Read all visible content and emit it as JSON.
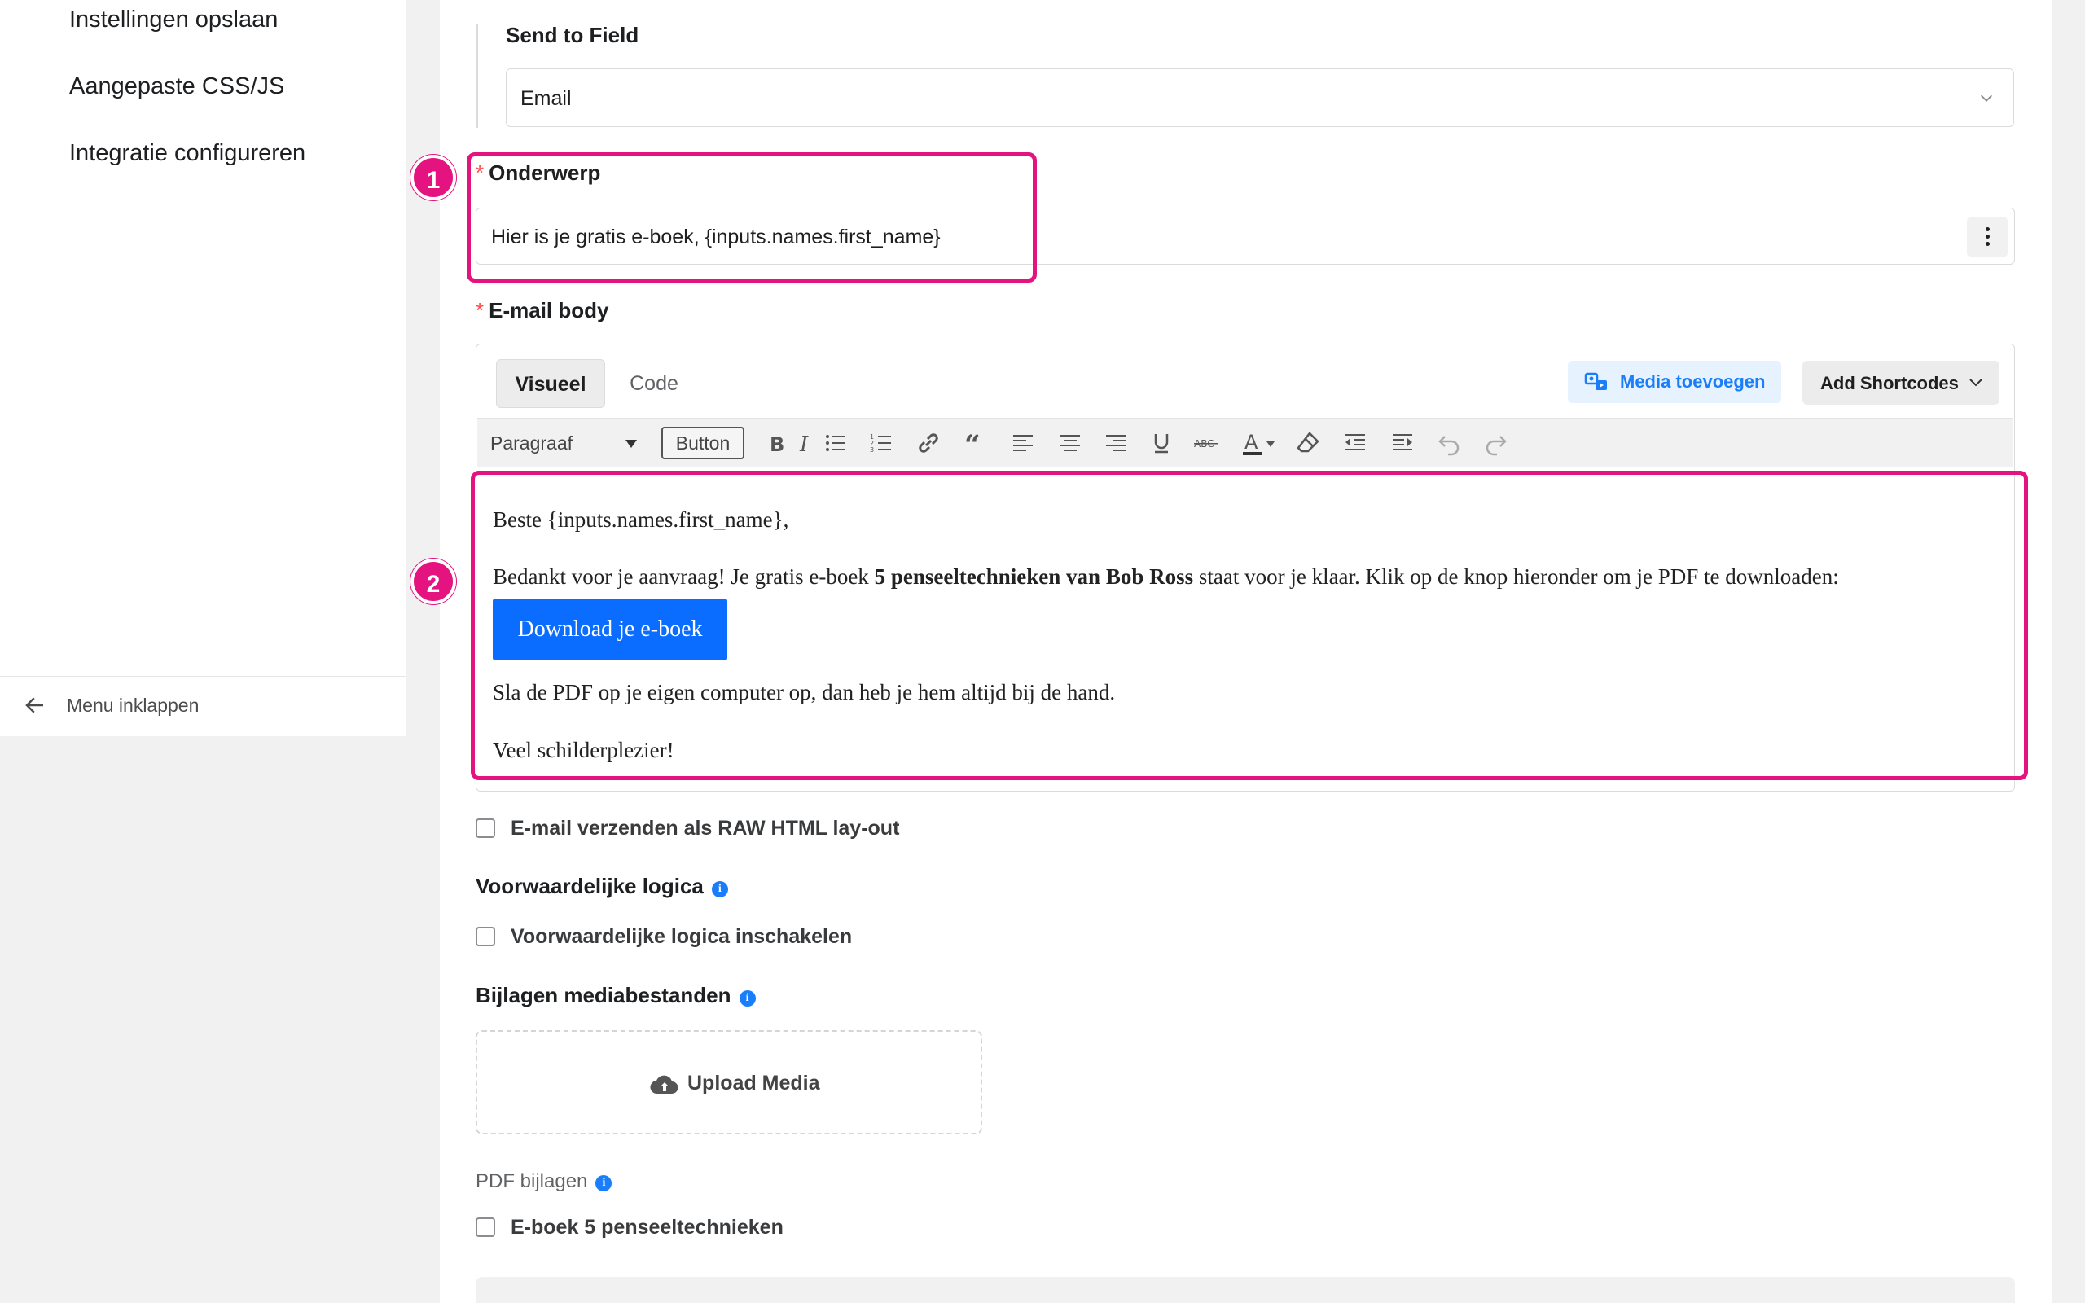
{
  "sidebar": {
    "items": [
      {
        "label": "Instellingen opslaan"
      },
      {
        "label": "Aangepaste CSS/JS"
      },
      {
        "label": "Integratie configureren"
      }
    ],
    "collapse_label": "Menu inklappen"
  },
  "form": {
    "send_to_field": {
      "label": "Send to Field",
      "value": "Email"
    },
    "subject": {
      "label": "Onderwerp",
      "value": "Hier is je gratis e-boek, {inputs.names.first_name}"
    },
    "email_body": {
      "label": "E-mail body",
      "tabs": [
        "Visueel",
        "Code"
      ],
      "active_tab": "Visueel",
      "media_button": "Media toevoegen",
      "shortcodes_button": "Add Shortcodes",
      "toolbar": {
        "format_select": "Paragraaf",
        "button_label": "Button",
        "icons": [
          "bold-icon",
          "italic-icon",
          "bullet-list-icon",
          "numbered-list-icon",
          "link-icon",
          "blockquote-icon",
          "align-left-icon",
          "align-center-icon",
          "align-right-icon",
          "underline-icon",
          "strikethrough-icon",
          "text-color-icon",
          "clear-format-icon",
          "outdent-icon",
          "indent-icon",
          "undo-icon",
          "redo-icon"
        ]
      },
      "content": {
        "greeting": "Beste {inputs.names.first_name},",
        "para_before": "Bedankt voor je aanvraag! Je gratis e-boek ",
        "para_bold": "5 penseeltechnieken van Bob Ross",
        "para_after": " staat voor je klaar. Klik op de knop hieronder om je PDF te downloaden:",
        "download_button": "Download je e-boek",
        "save_tip": "Sla de PDF op je eigen computer op, dan heb je hem altijd bij de hand.",
        "closing": "Veel schilderplezier!"
      }
    },
    "raw_html_checkbox": "E-mail verzenden als RAW HTML lay-out",
    "conditional_logic": {
      "title": "Voorwaardelijke logica",
      "checkbox": "Voorwaardelijke logica inschakelen"
    },
    "attachments": {
      "title": "Bijlagen mediabestanden",
      "upload_button": "Upload Media"
    },
    "pdf_attachments": {
      "label": "PDF bijlagen",
      "items": [
        "E-boek 5 penseeltechnieken"
      ]
    }
  },
  "annotations": [
    "1",
    "2"
  ],
  "colors": {
    "accent": "#1a7efb",
    "highlight": "#e4137f",
    "download_button": "#0a6dff",
    "required": "#ff4a4a"
  }
}
